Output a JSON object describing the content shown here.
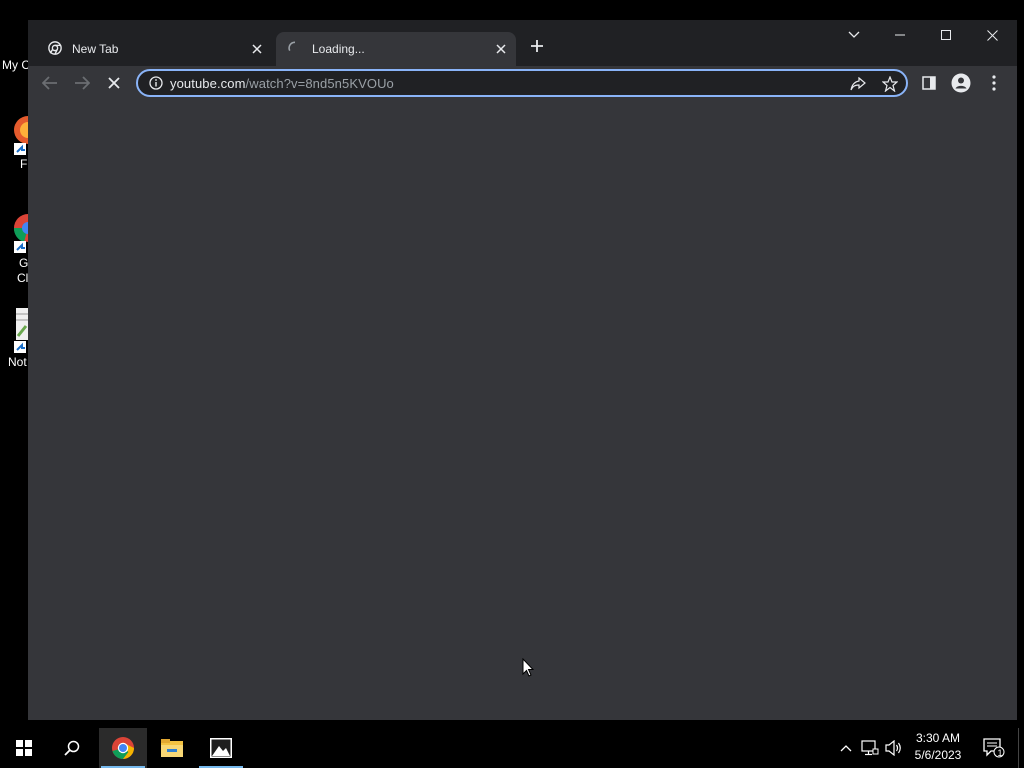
{
  "desktop": {
    "icons": [
      {
        "name": "my-computer",
        "label": "My C"
      },
      {
        "name": "firefox",
        "label": "F"
      },
      {
        "name": "google-chrome",
        "label_line1": "G",
        "label_line2": "Cl"
      },
      {
        "name": "notepad",
        "label": "Not"
      }
    ]
  },
  "browser": {
    "tabs": [
      {
        "title": "New Tab",
        "icon": "chrome-icon",
        "state": "inactive"
      },
      {
        "title": "Loading...",
        "icon": "loading-spinner-icon",
        "state": "active"
      }
    ],
    "address_bar": {
      "host": "youtube.com",
      "path": "/watch?v=8nd5n5KVOUo"
    },
    "reload_state": "stop",
    "colors": {
      "frame": "#202124",
      "toolbar": "#35363a",
      "focus_ring": "#8ab4f8"
    }
  },
  "taskbar": {
    "apps": [
      "start-icon",
      "search-icon",
      "chrome-icon",
      "file-explorer-icon",
      "photos-icon"
    ],
    "clock": {
      "time": "3:30 AM",
      "date": "5/6/2023"
    },
    "notification_count": "1"
  }
}
